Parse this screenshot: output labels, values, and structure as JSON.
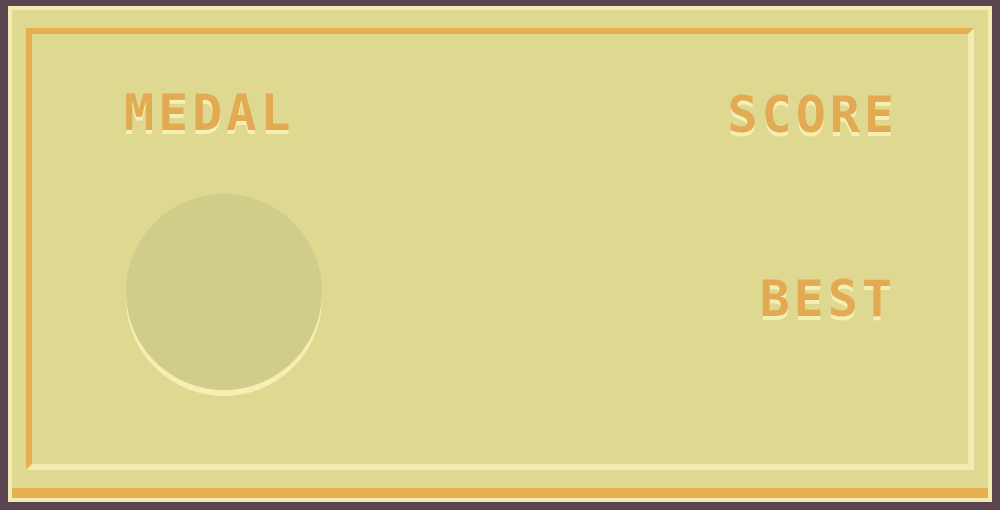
{
  "scoreboard": {
    "medal_label": "MEDAL",
    "score_label": "SCORE",
    "best_label": "BEST",
    "score_value": "",
    "best_value": "",
    "medal": "none"
  },
  "colors": {
    "panel_background": "#ded890",
    "label_orange": "#e2aa52",
    "highlight_cream": "#f6efb2",
    "medal_slot_empty": "#d0cc8a",
    "outer_border": "#5a4450"
  }
}
